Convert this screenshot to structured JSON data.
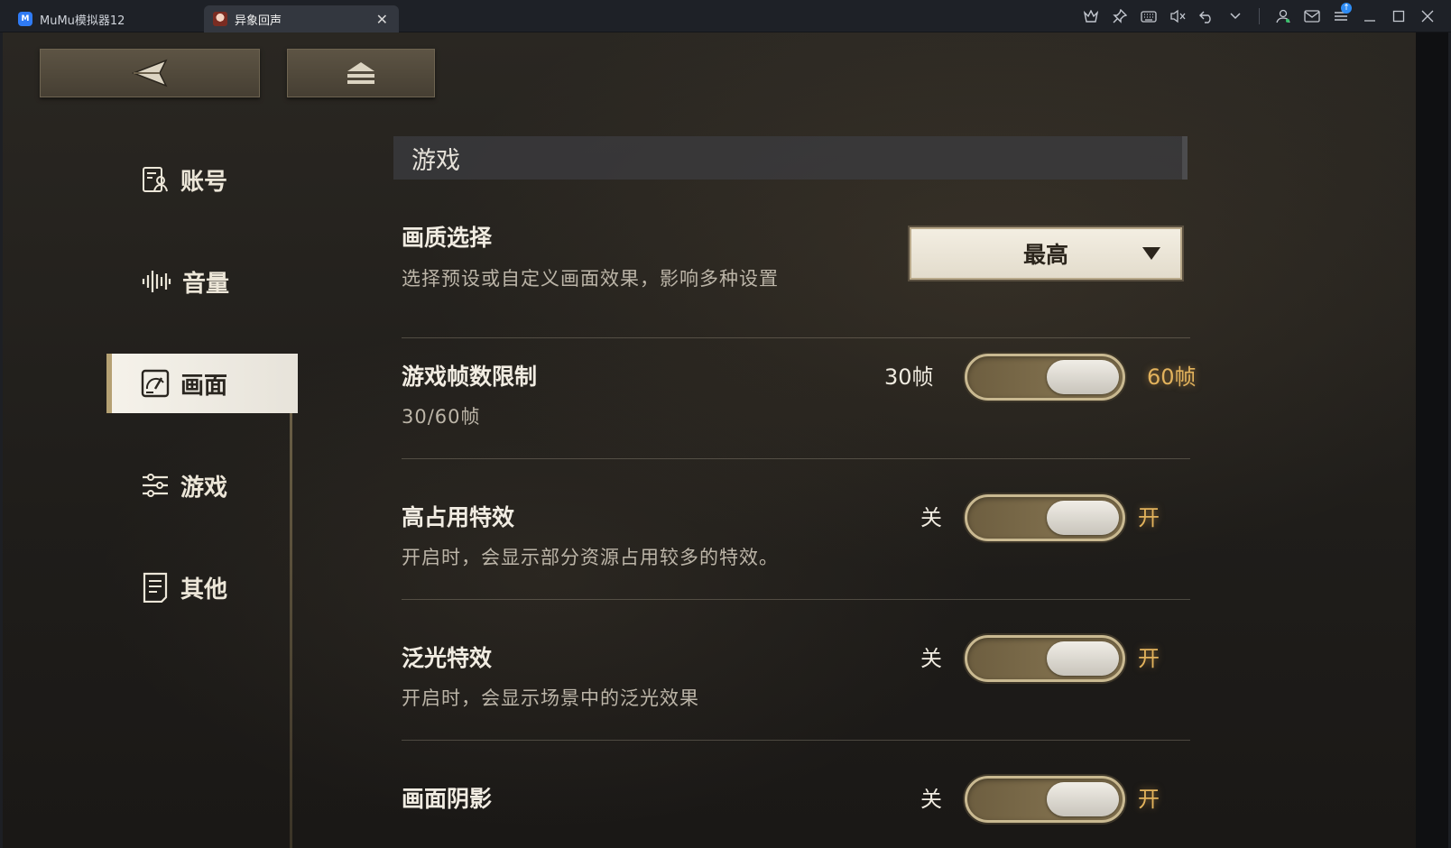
{
  "titlebar": {
    "tabs": [
      {
        "label": "MuMu模拟器12",
        "icon": "mumu-logo-icon"
      },
      {
        "label": "异象回声",
        "icon": "game-app-icon"
      }
    ],
    "close_glyph": "✕",
    "icons": [
      "crown-icon",
      "pin-icon",
      "keyboard-icon",
      "mute-icon",
      "undo-icon",
      "chevron-down-icon",
      "user-icon",
      "mail-icon",
      "menu-icon",
      "minimize-icon",
      "maximize-icon",
      "close-window-icon"
    ]
  },
  "sidebar": {
    "items": [
      {
        "label": "账号",
        "icon": "account-icon",
        "active": false
      },
      {
        "label": "音量",
        "icon": "volume-wave-icon",
        "active": false
      },
      {
        "label": "画面",
        "icon": "display-gauge-icon",
        "active": true
      },
      {
        "label": "游戏",
        "icon": "sliders-icon",
        "active": false
      },
      {
        "label": "其他",
        "icon": "document-icon",
        "active": false
      }
    ]
  },
  "content": {
    "section_title": "游戏",
    "quality": {
      "title": "画质选择",
      "desc": "选择预设或自定义画面效果，影响多种设置",
      "selected": "最高"
    },
    "fps": {
      "title": "游戏帧数限制",
      "desc": "30/60帧",
      "off_label": "30帧",
      "on_label": "60帧",
      "value": "60帧"
    },
    "high_fx": {
      "title": "高占用特效",
      "desc": "开启时，会显示部分资源占用较多的特效。",
      "off_label": "关",
      "on_label": "开",
      "value": "开"
    },
    "bloom": {
      "title": "泛光特效",
      "desc": "开启时，会显示场景中的泛光效果",
      "off_label": "关",
      "on_label": "开",
      "value": "开"
    },
    "shadow": {
      "title": "画面阴影",
      "off_label": "关",
      "on_label": "开",
      "value": "开"
    }
  },
  "colors": {
    "accent_gold": "#e2b25c",
    "toggle_track": "#8c7a55",
    "sidebar_active_bg": "#f5f2ea"
  }
}
